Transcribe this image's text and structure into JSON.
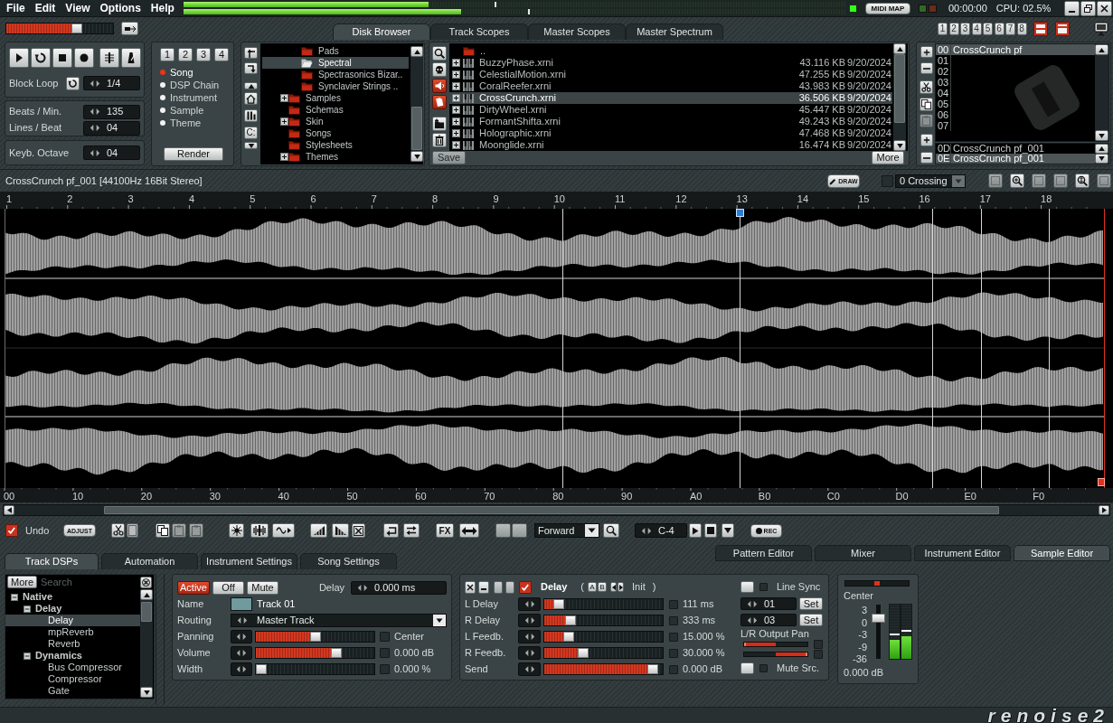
{
  "menu": [
    {
      "label": "File"
    },
    {
      "label": "Edit"
    },
    {
      "label": "View"
    },
    {
      "label": "Options"
    },
    {
      "label": "Help"
    }
  ],
  "output_meters": [
    {
      "level": 0.37
    },
    {
      "level": 0.42
    }
  ],
  "midi_map": "MIDI MAP",
  "time": "00:00:00",
  "cpu": "CPU: 02.5%",
  "master_volume": {
    "level": 0.68
  },
  "upper_tabs": [
    {
      "label": "Disk Browser",
      "selected": true
    },
    {
      "label": "Track Scopes",
      "selected": false
    },
    {
      "label": "Master Scopes",
      "selected": false
    },
    {
      "label": "Master Spectrum",
      "selected": false
    }
  ],
  "track_buttons": [
    "1",
    "2",
    "3",
    "4",
    "5",
    "6",
    "7",
    "8"
  ],
  "transport": {
    "block_loop": {
      "label": "Block Loop",
      "value": "1/4"
    },
    "tempo": [
      {
        "label": "Beats / Min.",
        "value": "135"
      },
      {
        "label": "Lines / Beat",
        "value": "04"
      }
    ],
    "octave": {
      "label": "Keyb. Octave",
      "value": "04"
    }
  },
  "render": {
    "slots": [
      "1",
      "2",
      "3",
      "4"
    ],
    "options": [
      {
        "label": "Song",
        "selected": true
      },
      {
        "label": "DSP Chain",
        "selected": false
      },
      {
        "label": "Instrument",
        "selected": false
      },
      {
        "label": "Sample",
        "selected": false
      },
      {
        "label": "Theme",
        "selected": false
      }
    ],
    "button": "Render"
  },
  "folder_tools": {
    "drive": "C:"
  },
  "folders": [
    {
      "children": [
        {
          "label": "Pads",
          "selected": false,
          "expandable": false
        },
        {
          "label": "Spectral",
          "selected": true,
          "expandable": false
        },
        {
          "label": "Spectrasonics Bizar..",
          "selected": false,
          "expandable": false
        },
        {
          "label": "Synclavier Strings ..",
          "selected": false,
          "expandable": false
        }
      ]
    },
    {
      "label": "Samples",
      "selected": false,
      "expandable": true
    },
    {
      "label": "Schemas",
      "selected": false,
      "expandable": false
    },
    {
      "label": "Skin",
      "selected": false,
      "expandable": true
    },
    {
      "label": "Songs",
      "selected": false,
      "expandable": false
    },
    {
      "label": "Stylesheets",
      "selected": false,
      "expandable": false
    },
    {
      "label": "Themes",
      "selected": false,
      "expandable": true
    }
  ],
  "files": {
    "items": [
      {
        "kind": "parent",
        "name": "..",
        "selected": false
      },
      {
        "kind": "instrument",
        "name": "BuzzyPhase.xrni",
        "size": "43.116 KB",
        "date": "9/20/2024",
        "selected": false
      },
      {
        "kind": "instrument",
        "name": "CelestialMotion.xrni",
        "size": "47.255 KB",
        "date": "9/20/2024",
        "selected": false
      },
      {
        "kind": "instrument",
        "name": "CoralReefer.xrni",
        "size": "43.983 KB",
        "date": "9/20/2024",
        "selected": false
      },
      {
        "kind": "instrument",
        "name": "CrossCrunch.xrni",
        "size": "36.506 KB",
        "date": "9/20/2024",
        "selected": true
      },
      {
        "kind": "instrument",
        "name": "DirtyWheel.xrni",
        "size": "45.447 KB",
        "date": "9/20/2024",
        "selected": false
      },
      {
        "kind": "instrument",
        "name": "FormantShifta.xrni",
        "size": "49.243 KB",
        "date": "9/20/2024",
        "selected": false
      },
      {
        "kind": "instrument",
        "name": "Holographic.xrni",
        "size": "47.468 KB",
        "date": "9/20/2024",
        "selected": false
      },
      {
        "kind": "instrument",
        "name": "Moonglide.xrni",
        "size": "16.474 KB",
        "date": "9/20/2024",
        "selected": false
      }
    ],
    "save": {
      "label": "Save",
      "disabled": true
    },
    "more": "More"
  },
  "instruments": {
    "upper": [
      {
        "index": "00",
        "name": "CrossCrunch pf",
        "selected": true
      },
      {
        "index": "01",
        "selected": false
      },
      {
        "index": "02",
        "selected": false
      },
      {
        "index": "03",
        "selected": false
      },
      {
        "index": "04",
        "selected": false
      },
      {
        "index": "05",
        "selected": false
      },
      {
        "index": "06",
        "selected": false
      },
      {
        "index": "07",
        "selected": false
      }
    ],
    "lower": [
      {
        "index": "0D",
        "name": "CrossCrunch pf_001",
        "selected": false
      },
      {
        "index": "0E",
        "name": "CrossCrunch pf_001",
        "selected": true
      }
    ]
  },
  "sample_editor": {
    "title": "CrossCrunch pf_001 [44100Hz 16Bit Stereo]",
    "draw": "DRAW",
    "zero_crossing": {
      "checked": false,
      "label": "0 Crossing"
    },
    "ruler": [
      "1",
      "2",
      "3",
      "4",
      "5",
      "6",
      "7",
      "8",
      "9",
      "10",
      "11",
      "12",
      "13",
      "14",
      "15",
      "16",
      "17",
      "18"
    ],
    "offsets": [
      "00",
      "10",
      "20",
      "30",
      "40",
      "50",
      "60",
      "70",
      "80",
      "90",
      "A0",
      "B0",
      "C0",
      "D0",
      "E0",
      "F0"
    ]
  },
  "toolbar": {
    "undo": {
      "label": "Undo",
      "checked": true
    },
    "adjust": "ADJUST",
    "fx": "FX",
    "loop_mode": "Forward",
    "note": "C-4",
    "rec": "REC"
  },
  "panel_tabs": [
    {
      "label": "Track DSPs",
      "selected": true
    },
    {
      "label": "Automation",
      "selected": false
    },
    {
      "label": "Instrument Settings",
      "selected": false
    },
    {
      "label": "Song Settings",
      "selected": false
    }
  ],
  "view_tabs": [
    {
      "label": "Pattern Editor",
      "selected": false
    },
    {
      "label": "Mixer",
      "selected": false
    },
    {
      "label": "Instrument Editor",
      "selected": false
    },
    {
      "label": "Sample Editor",
      "selected": true
    }
  ],
  "dsp_browser": {
    "more": "More",
    "search": {
      "placeholder": "Search"
    },
    "tree": [
      {
        "label": "Native",
        "expanded": true,
        "selected": false,
        "children": [
          {
            "label": "Delay",
            "expanded": true,
            "selected": false,
            "children": [
              {
                "label": "Delay",
                "selected": true
              },
              {
                "label": "mpReverb",
                "selected": false
              },
              {
                "label": "Reverb",
                "selected": false
              }
            ]
          },
          {
            "label": "Dynamics",
            "expanded": true,
            "selected": false,
            "children": [
              {
                "label": "Bus Compressor",
                "selected": false
              },
              {
                "label": "Compressor",
                "selected": false
              },
              {
                "label": "Gate",
                "selected": false
              }
            ]
          }
        ]
      }
    ]
  },
  "track": {
    "states": [
      {
        "label": "Active",
        "on": true
      },
      {
        "label": "Off",
        "on": false
      },
      {
        "label": "Mute",
        "on": false
      }
    ],
    "delay": {
      "label": "Delay",
      "value": "0.000 ms"
    },
    "name": {
      "label": "Name",
      "value": "Track 01",
      "color": "#6f9b9d"
    },
    "routing": {
      "label": "Routing",
      "value": "Master Track"
    },
    "params": [
      {
        "label": "Panning",
        "level": 0.5,
        "checked": false,
        "value": "Center"
      },
      {
        "label": "Volume",
        "level": 0.7,
        "checked": false,
        "value": "0.000 dB"
      },
      {
        "label": "Width",
        "level": 0,
        "checked": false,
        "value": "0.000 %"
      }
    ]
  },
  "delay_device": {
    "enabled": true,
    "name": "Delay",
    "preset_open": "(",
    "slots": [
      "A",
      "B"
    ],
    "preset": "Init",
    "preset_close": ")",
    "params": [
      {
        "label": "L Delay",
        "level": 0.08,
        "checked": false,
        "value": "111 ms"
      },
      {
        "label": "R Delay",
        "level": 0.19,
        "checked": false,
        "value": "333 ms"
      },
      {
        "label": "L Feedb.",
        "level": 0.18,
        "checked": false,
        "value": "15.000 %"
      },
      {
        "label": "R Feedb.",
        "level": 0.31,
        "checked": false,
        "value": "30.000 %"
      },
      {
        "label": "Send",
        "level": 0.96,
        "checked": false,
        "value": "0.000 dB"
      }
    ],
    "line_sync": {
      "label": "Line Sync",
      "on": false
    },
    "sync": [
      {
        "value": "01",
        "button": "Set"
      },
      {
        "value": "03",
        "button": "Set"
      }
    ],
    "output_pan": {
      "label": "L/R Output Pan",
      "sliders": [
        {
          "level": 0,
          "checked": false
        },
        {
          "level": 1,
          "checked": false
        }
      ]
    },
    "mute_source": {
      "label": "Mute Src.",
      "on": false
    }
  },
  "mixer": {
    "pan": {
      "level": 0.5
    },
    "pan_label": "Center",
    "scale": [
      "3",
      "0",
      "-3",
      "-9",
      "-36"
    ],
    "fader": {
      "level": 0.79
    },
    "meters": [
      {
        "level": 0.35
      },
      {
        "level": 0.42
      }
    ],
    "volume": "0.000 dB"
  },
  "logo": "renoise2"
}
